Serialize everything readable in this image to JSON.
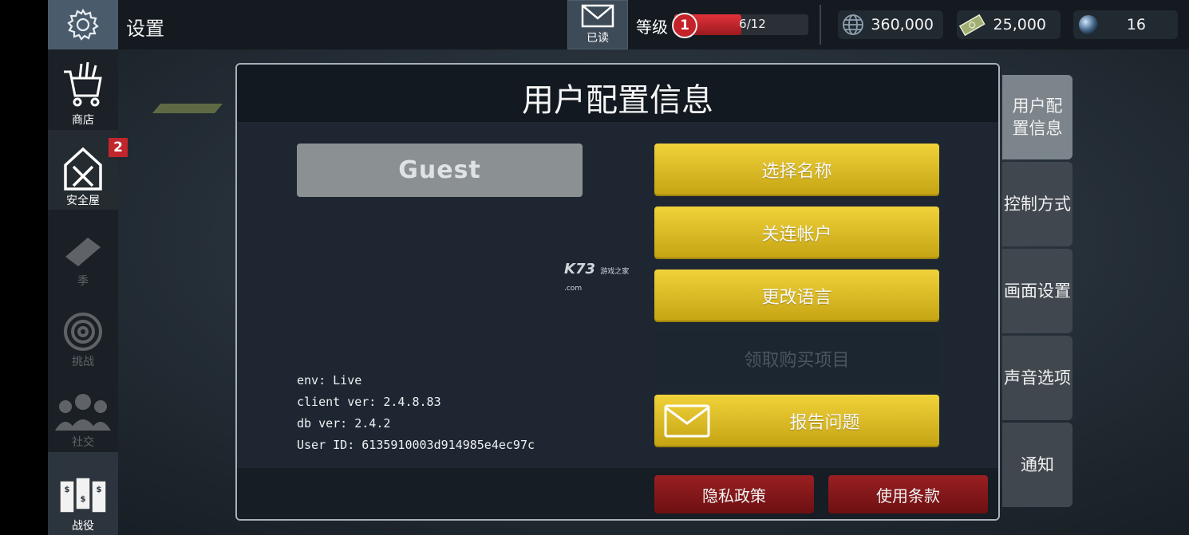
{
  "topbar": {
    "title": "设置",
    "mail_label": "已读",
    "level_label": "等级",
    "level_number": "1",
    "level_progress_text": "6/12",
    "level_progress": 0.5,
    "currencies": [
      {
        "icon": "globe-icon",
        "value": "360,000"
      },
      {
        "icon": "cash-icon",
        "value": "25,000"
      },
      {
        "icon": "gem-icon",
        "value": "16"
      }
    ]
  },
  "sidebar": {
    "items": [
      {
        "id": "settings",
        "icon": "gear-icon",
        "label": ""
      },
      {
        "id": "shop",
        "icon": "cart-icon",
        "label": "商店"
      },
      {
        "id": "safehouse",
        "icon": "safehouse-icon",
        "label": "安全屋",
        "badge": "2"
      },
      {
        "id": "season",
        "icon": "ticket-icon",
        "label": "季",
        "disabled": true
      },
      {
        "id": "challenge",
        "icon": "target-icon",
        "label": "挑战",
        "disabled": true
      },
      {
        "id": "social",
        "icon": "people-icon",
        "label": "社交",
        "disabled": true
      },
      {
        "id": "campaign",
        "icon": "map-icon",
        "label": "战役"
      }
    ]
  },
  "dialog": {
    "title": "用户配置信息",
    "username": "Guest",
    "info": {
      "env": "env: Live",
      "client": "client ver: 2.4.8.83",
      "db": "db ver: 2.4.2",
      "uid": "User ID: 6135910003d914985e4ec97c"
    },
    "buttons": {
      "choose_name": "选择名称",
      "link_account": "关连帐户",
      "change_language": "更改语言",
      "claim_purchase": "领取购买项目",
      "report_issue": "报告问题",
      "privacy": "隐私政策",
      "terms": "使用条款"
    },
    "watermark": {
      "main": "K73",
      "small_top": "游戏之家",
      "small_bottom": ".com"
    }
  },
  "tabs": [
    {
      "label": "用户配置信息",
      "active": true
    },
    {
      "label": "控制方式"
    },
    {
      "label": "画面设置"
    },
    {
      "label": "声音选项"
    },
    {
      "label": "通知"
    }
  ],
  "colors": {
    "accent_yellow": "#e3c42b",
    "accent_red": "#8a1a1d",
    "level_red": "#d62c33"
  }
}
